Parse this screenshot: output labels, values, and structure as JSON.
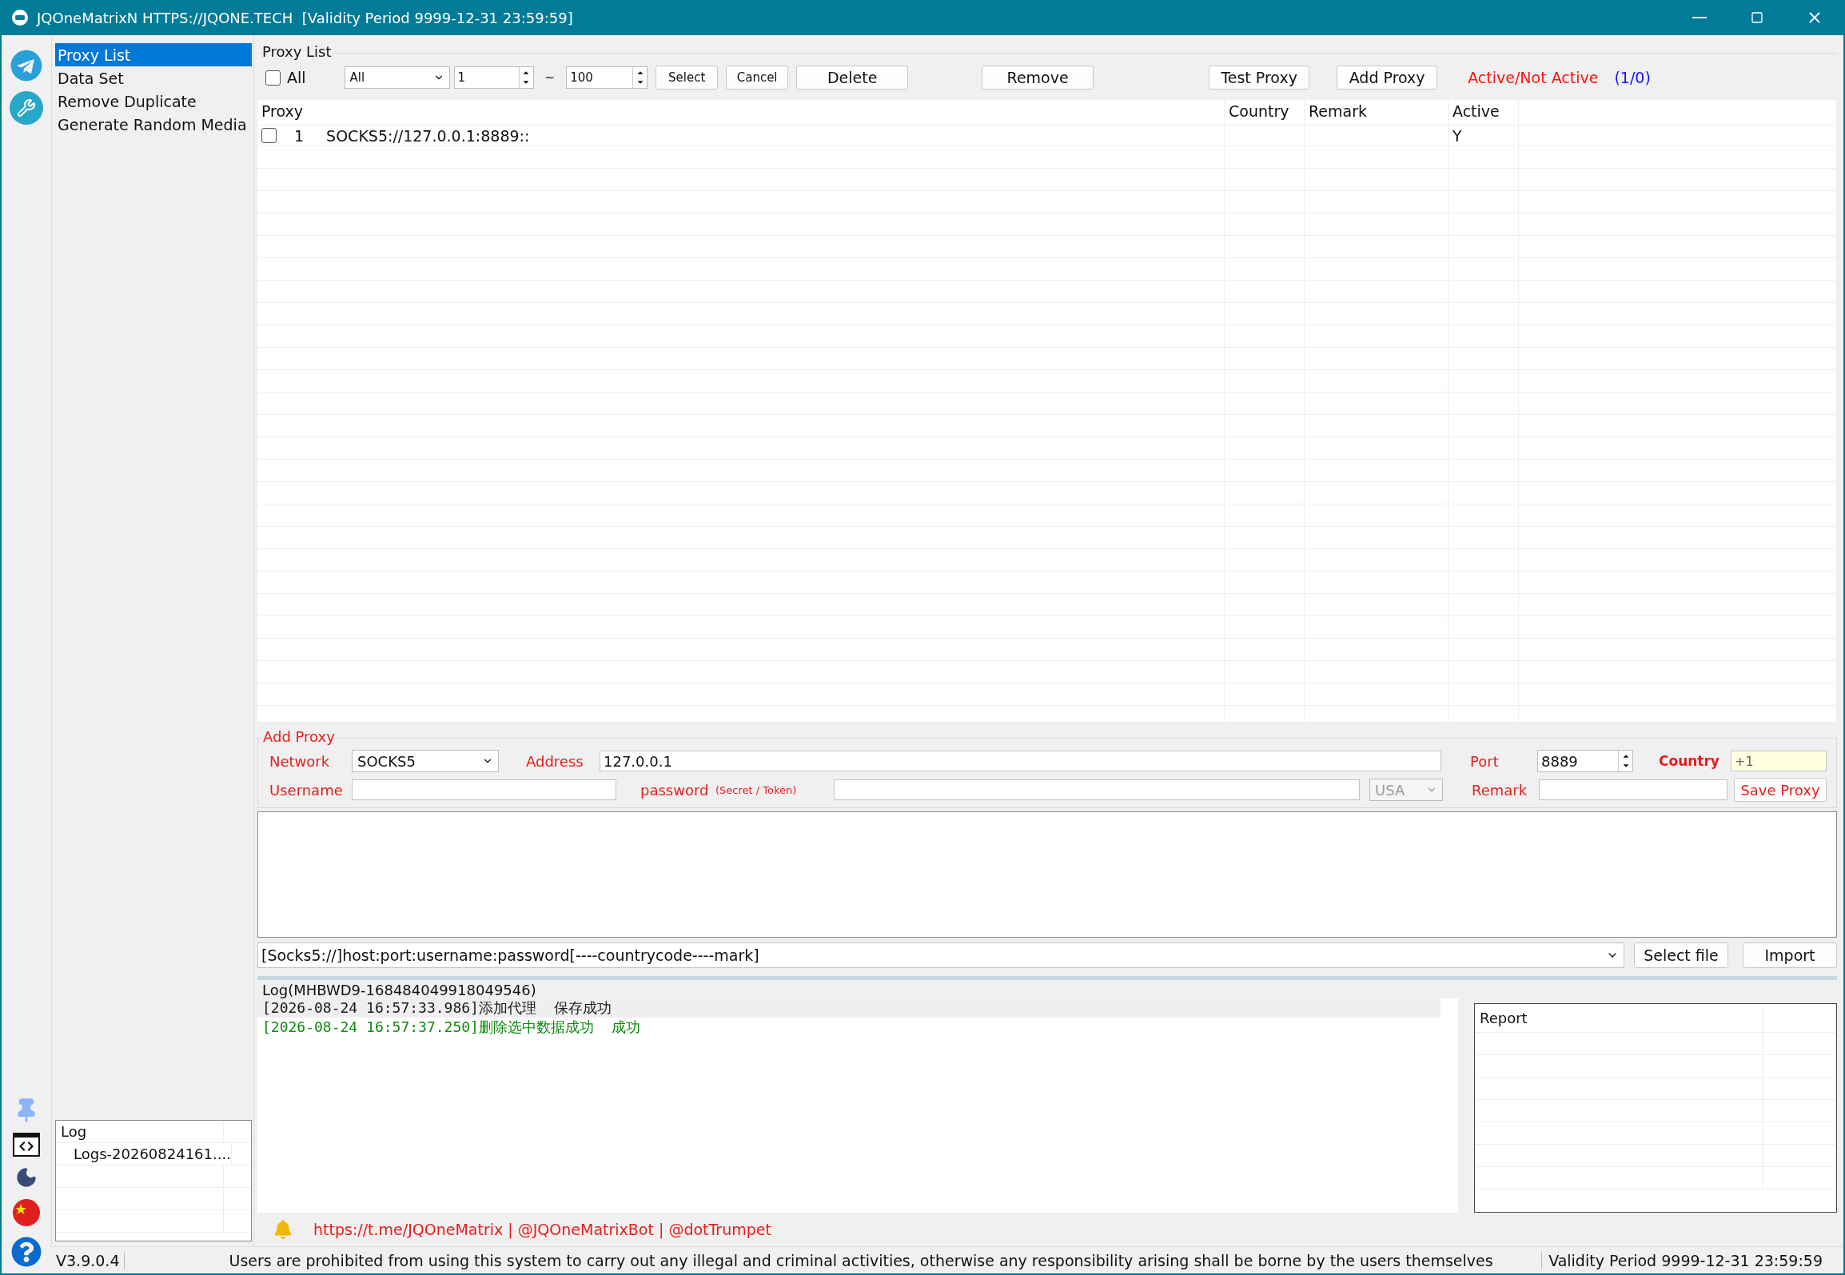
{
  "window": {
    "title": "JQOneMatrixN HTTPS://JQONE.TECH  [Validity Period 9999-12-31 23:59:59]"
  },
  "nav": [
    {
      "label": "Proxy List",
      "selected": true
    },
    {
      "label": "Data Set",
      "selected": false
    },
    {
      "label": "Remove Duplicate",
      "selected": false
    },
    {
      "label": "Generate Random Media",
      "selected": false
    }
  ],
  "log_files": {
    "title": "Log",
    "items": [
      "Logs-20260824161...."
    ]
  },
  "proxy_list": {
    "title": "Proxy List",
    "select_all": {
      "label": "All",
      "checked": false
    },
    "filter": "All",
    "range_from": "1",
    "range_separator": "~",
    "range_to": "100",
    "buttons": [
      {
        "label": "Select",
        "kind": "small"
      },
      {
        "label": "Cancel",
        "kind": "small"
      },
      {
        "label": "Delete",
        "kind": "wide"
      },
      {
        "label": "Remove",
        "kind": "wide"
      },
      {
        "label": "Test Proxy",
        "kind": "medium"
      },
      {
        "label": "Add Proxy",
        "kind": "medium"
      }
    ],
    "status_label": "Active/Not Active",
    "status_count": "(1/0)"
  },
  "table": {
    "columns": [
      "Proxy",
      "Country",
      "Remark",
      "Active"
    ],
    "rows": [
      {
        "checked": false,
        "index": "1",
        "proxy": "SOCKS5://127.0.0.1:8889::",
        "active": "Y"
      }
    ]
  },
  "add_proxy": {
    "title": "Add Proxy",
    "network_label": "Network",
    "network": "SOCKS5",
    "address_label": "Address",
    "address": "127.0.0.1",
    "port_label": "Port",
    "port": "8889",
    "country_label": "Country",
    "country": "+1",
    "username_label": "Username",
    "password_label": "password",
    "password_hint": "(Secret / Token)",
    "country_select": {
      "value": "USA",
      "disabled": true
    },
    "remark_label": "Remark",
    "save_button": "Save Proxy"
  },
  "import": {
    "format": "[Socks5://]host:port:username:password[----countrycode----mark]",
    "buttons": [
      "Select file",
      "Import"
    ]
  },
  "log": {
    "title": "Log(MHBWD9-168484049918049546)",
    "entries": [
      {
        "time": "[2026-08-24 16:57:33.986]",
        "message": "添加代理  保存成功",
        "color": "#1a1a1a",
        "highlighted": true
      },
      {
        "time": "[2026-08-24 16:57:37.250]",
        "message": "删除选中数据成功  成功",
        "color": "#108a10",
        "highlighted": false
      }
    ]
  },
  "report": {
    "title": "Report"
  },
  "footer": {
    "links": "https://t.me/JQOneMatrix | @JQOneMatrixBot | @dotTrumpet"
  },
  "status_bar": {
    "version": "V3.9.0.4",
    "notice": "Users are prohibited from using this system to carry out any illegal and criminal activities, otherwise any responsibility arising shall be borne by the users themselves",
    "validity": "Validity Period 9999-12-31 23:59:59"
  }
}
